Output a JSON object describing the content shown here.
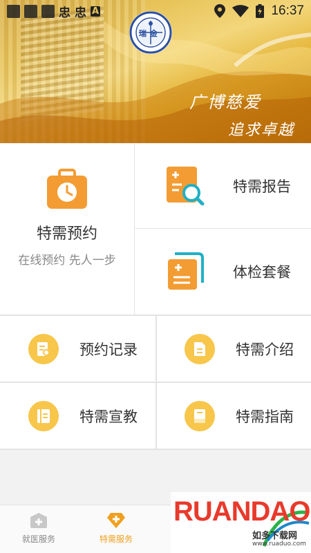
{
  "statusbar": {
    "time": "16:37",
    "glyph_a": "忠",
    "glyph_b": "忠",
    "glyph_c": "A"
  },
  "banner": {
    "logo_text": "瑞金",
    "slogan_line1": "广博慈爱",
    "slogan_line2": "追求卓越"
  },
  "main": {
    "appointment": {
      "title": "特需预约",
      "subtitle": "在线预约 先人一步",
      "icon": "clock-bag-icon"
    },
    "report": {
      "label": "特需报告",
      "icon": "report-search-icon"
    },
    "checkup": {
      "label": "体检套餐",
      "icon": "checkup-package-icon"
    },
    "records": {
      "label": "预约记录",
      "icon": "record-doc-icon"
    },
    "intro": {
      "label": "特需介绍",
      "icon": "intro-doc-icon"
    },
    "education": {
      "label": "特需宣教",
      "icon": "education-doc-icon"
    },
    "guide": {
      "label": "特需指南",
      "icon": "guide-book-icon"
    }
  },
  "bottom_nav": {
    "items": [
      {
        "label": "就医服务",
        "icon": "medical-cross-icon",
        "active": false
      },
      {
        "label": "特需服务",
        "icon": "diamond-cross-icon",
        "active": true
      }
    ]
  },
  "watermark": {
    "brand": "RUANDAO",
    "sub": "如多下载网",
    "url": "www.ruaduo.com"
  },
  "colors": {
    "accent": "#f5a623",
    "orange": "#f39c33",
    "yellow": "#f7c64b",
    "active_nav": "#f0a020"
  }
}
